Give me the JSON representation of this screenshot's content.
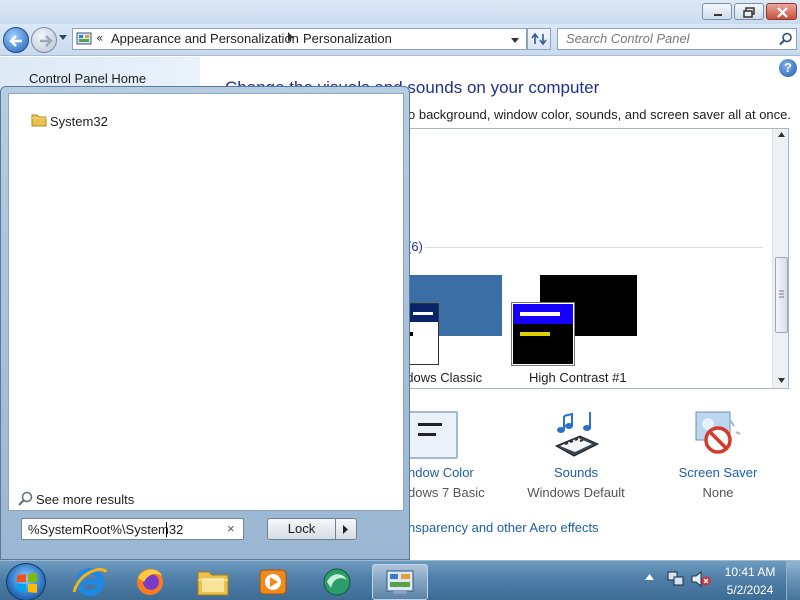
{
  "window": {
    "address": {
      "chevron": "«",
      "crumb1": "Appearance and Personalization",
      "crumb2": "Personalization"
    },
    "search_placeholder": "Search Control Panel",
    "help": "?"
  },
  "left_pane": {
    "home_link": "Control Panel Home"
  },
  "main": {
    "heading": "Change the visuals and sounds on your computer",
    "subheading": "o background, window color, sounds, and screen saver all at once.",
    "group_count": "(6)",
    "themes": [
      {
        "label": "ndows Classic"
      },
      {
        "label": "High Contrast #1"
      }
    ],
    "bottom": {
      "window_color": {
        "title": "ndow Color",
        "sub": "dows 7 Basic"
      },
      "sounds": {
        "title": "Sounds",
        "sub": "Windows Default"
      },
      "screen_saver": {
        "title": "Screen Saver",
        "sub": "None"
      }
    },
    "aero_link": "nsparency and other Aero effects"
  },
  "start_menu": {
    "results": [
      {
        "label": "System32",
        "icon": "folder-icon"
      }
    ],
    "see_more": "See more results",
    "search_value": "%SystemRoot%\\System32",
    "clear_glyph": "×",
    "power_button": "Lock"
  },
  "taskbar": {
    "items": [
      "internet-explorer-icon",
      "firefox-icon",
      "windows-explorer-icon",
      "media-player-icon",
      "app-icon",
      "control-panel-icon"
    ],
    "clock": {
      "time": "10:41 AM",
      "date": "5/2/2024"
    }
  },
  "colors": {
    "link": "#1e5ea8",
    "heading": "#1e3287",
    "taskbar": "#4f7fa8"
  }
}
